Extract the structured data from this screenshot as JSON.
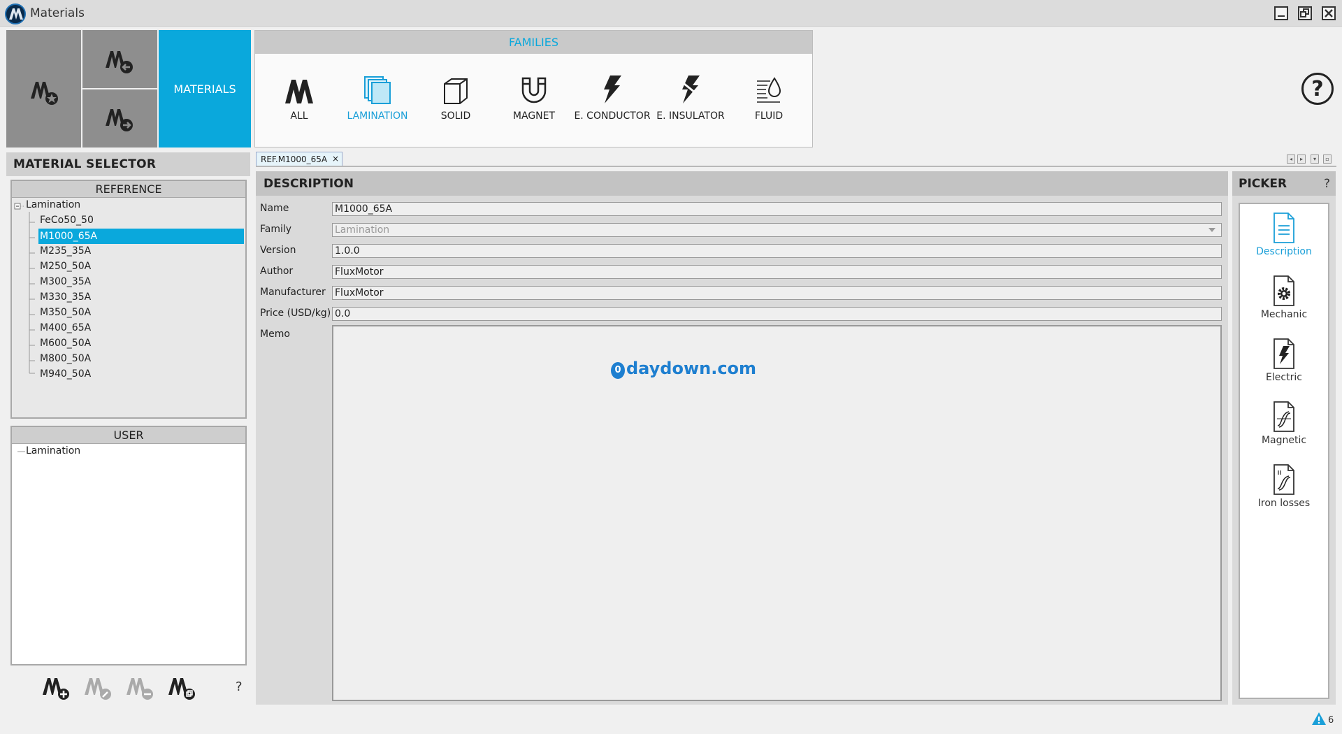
{
  "window": {
    "title": "Materials"
  },
  "toolbar": {
    "materials_label": "MATERIALS"
  },
  "families": {
    "header": "FAMILIES",
    "items": [
      {
        "label": "ALL",
        "icon": "all-materials-icon"
      },
      {
        "label": "LAMINATION",
        "icon": "lamination-icon",
        "active": true
      },
      {
        "label": "SOLID",
        "icon": "solid-cube-icon"
      },
      {
        "label": "MAGNET",
        "icon": "magnet-icon"
      },
      {
        "label": "E. CONDUCTOR",
        "icon": "lightning-icon"
      },
      {
        "label": "E. INSULATOR",
        "icon": "insulator-lightning-icon"
      },
      {
        "label": "FLUID",
        "icon": "fluid-drop-icon"
      }
    ]
  },
  "selector": {
    "title": "MATERIAL SELECTOR",
    "reference": {
      "title": "REFERENCE",
      "root": "Lamination",
      "items": [
        "FeCo50_50",
        "M1000_65A",
        "M235_35A",
        "M250_50A",
        "M300_35A",
        "M330_35A",
        "M350_50A",
        "M400_65A",
        "M600_50A",
        "M800_50A",
        "M940_50A"
      ],
      "selected": "M1000_65A"
    },
    "user": {
      "title": "USER",
      "root": "Lamination"
    },
    "help": "?"
  },
  "tab": {
    "label": "REF.M1000_65A",
    "close": "×"
  },
  "description": {
    "title": "DESCRIPTION",
    "fields": {
      "name_label": "Name",
      "name_value": "M1000_65A",
      "family_label": "Family",
      "family_value": "Lamination",
      "version_label": "Version",
      "version_value": "1.0.0",
      "author_label": "Author",
      "author_value": "FluxMotor",
      "manufacturer_label": "Manufacturer",
      "manufacturer_value": "FluxMotor",
      "price_label": "Price (USD/kg)",
      "price_value": "0.0",
      "memo_label": "Memo"
    },
    "watermark": "daydown.com",
    "watermark_badge": "0"
  },
  "picker": {
    "title": "PICKER",
    "help": "?",
    "items": [
      {
        "label": "Description",
        "icon": "description-doc-icon",
        "active": true
      },
      {
        "label": "Mechanic",
        "icon": "mechanic-gear-doc-icon"
      },
      {
        "label": "Electric",
        "icon": "electric-doc-icon"
      },
      {
        "label": "Magnetic",
        "icon": "magnetic-curve-doc-icon"
      },
      {
        "label": "Iron losses",
        "icon": "iron-losses-doc-icon"
      }
    ]
  },
  "status": {
    "warning_count": "6"
  },
  "colors": {
    "accent": "#0aa8dc",
    "tile_gray": "#8e8e8e"
  }
}
